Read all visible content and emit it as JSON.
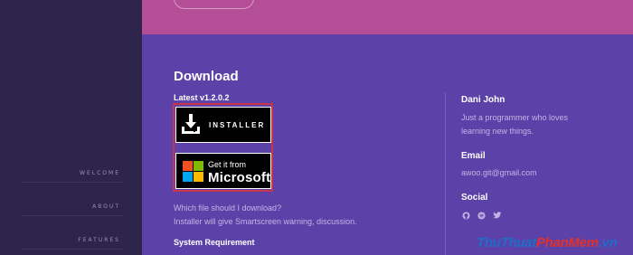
{
  "sidebar": {
    "items": [
      {
        "label": "WELCOME"
      },
      {
        "label": "ABOUT"
      },
      {
        "label": "FEATURES"
      }
    ]
  },
  "download": {
    "title": "Download",
    "latest": "Latest v1.2.0.2",
    "installer_label": "INSTALLER",
    "store_small": "Get it from",
    "store_big": "Microsoft",
    "which_link": "Which file should I download?",
    "which_desc": "Installer will give Smartscreen warning, discussion.",
    "system_requirement": "System Requirement"
  },
  "author": {
    "name": "Dani John",
    "bio_line1": "Just a programmer who loves",
    "bio_line2": "learning new things.",
    "email_heading": "Email",
    "email": "awoo.git@gmail.com",
    "social_heading": "Social",
    "social_icons": [
      "github-icon",
      "spotify-icon",
      "twitter-icon"
    ]
  },
  "watermark": {
    "part1": "ThuThuat",
    "part2": "PhanMem",
    "part3": ".vn"
  },
  "colors": {
    "background": "#5c41a8",
    "sidebar": "#2e254d",
    "top_band": "#b44e96",
    "highlight_border": "#c8344a"
  }
}
